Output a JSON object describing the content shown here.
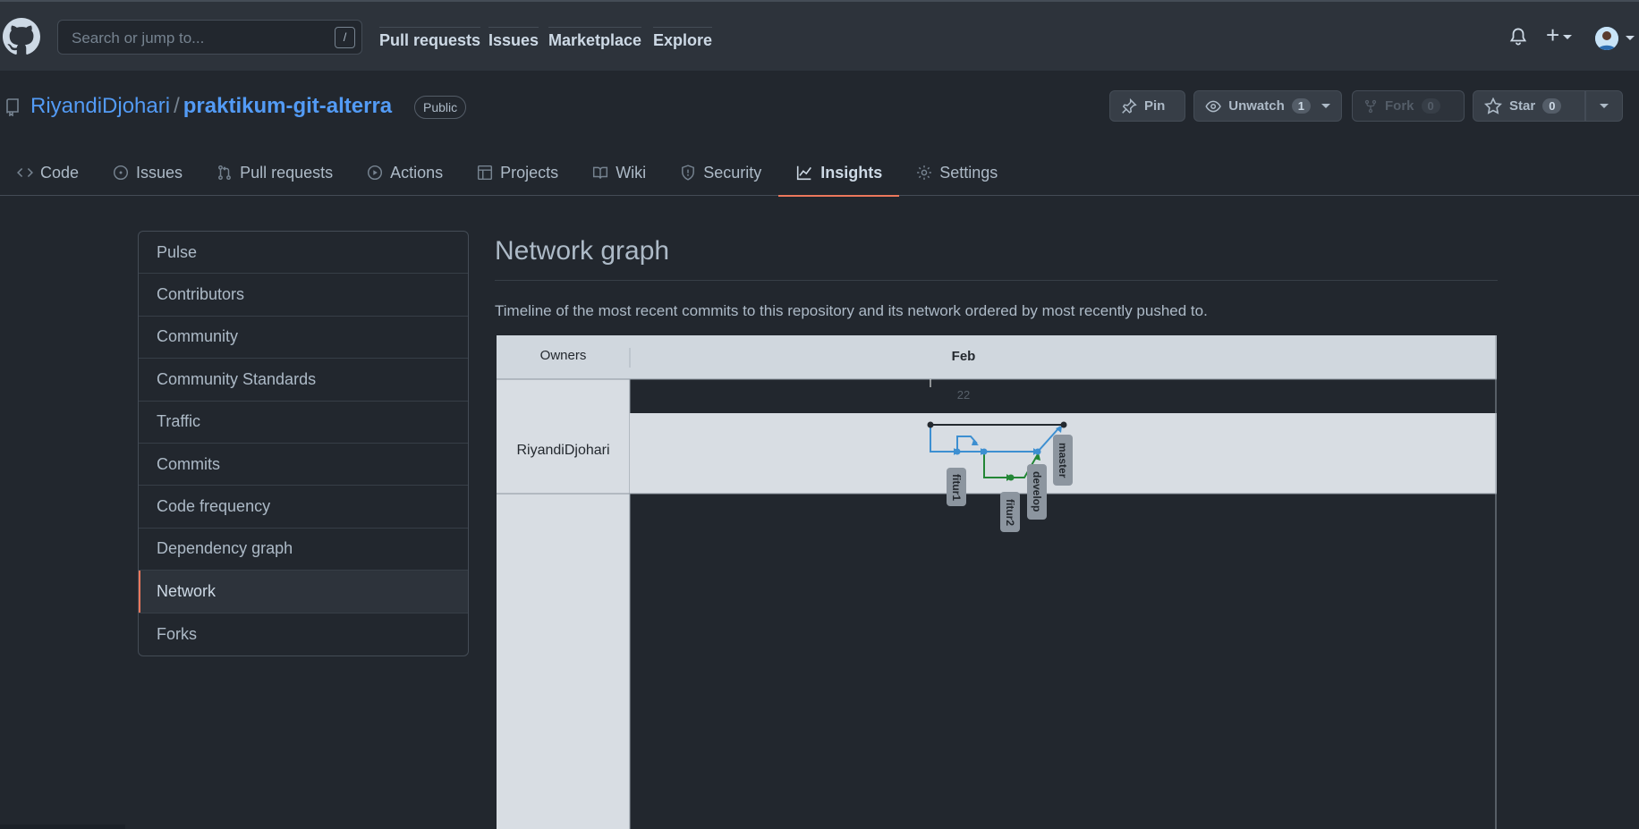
{
  "header": {
    "search_placeholder": "Search or jump to...",
    "search_key": "/",
    "nav": [
      "Pull requests",
      "Issues",
      "Marketplace",
      "Explore"
    ]
  },
  "repo": {
    "owner": "RiyandiDjohari",
    "separator": "/",
    "name": "praktikum-git-alterra",
    "visibility": "Public",
    "pin_label": "Pin",
    "unwatch_label": "Unwatch",
    "watch_count": "1",
    "fork_label": "Fork",
    "fork_count": "0",
    "star_label": "Star",
    "star_count": "0"
  },
  "tabs": [
    {
      "label": "Code",
      "icon": "code-icon"
    },
    {
      "label": "Issues",
      "icon": "issue-opened-icon"
    },
    {
      "label": "Pull requests",
      "icon": "git-pull-request-icon"
    },
    {
      "label": "Actions",
      "icon": "play-icon"
    },
    {
      "label": "Projects",
      "icon": "table-icon"
    },
    {
      "label": "Wiki",
      "icon": "book-icon"
    },
    {
      "label": "Security",
      "icon": "shield-icon"
    },
    {
      "label": "Insights",
      "icon": "graph-icon",
      "active": true
    },
    {
      "label": "Settings",
      "icon": "gear-icon"
    }
  ],
  "sidebar": {
    "items": [
      "Pulse",
      "Contributors",
      "Community",
      "Community Standards",
      "Traffic",
      "Commits",
      "Code frequency",
      "Dependency graph",
      "Network",
      "Forks"
    ],
    "active": "Network"
  },
  "main": {
    "title": "Network graph",
    "description": "Timeline of the most recent commits to this repository and its network ordered by most recently pushed to."
  },
  "network": {
    "owners_label": "Owners",
    "month": "Feb",
    "day": "22",
    "owner": "RiyandiDjohari",
    "branches": [
      "fitur1",
      "fitur2",
      "develop",
      "master"
    ],
    "colors": {
      "master": "#24292f",
      "develop": "#3d8fd1",
      "fitur2": "#238636",
      "accent": "#ec775c"
    }
  }
}
